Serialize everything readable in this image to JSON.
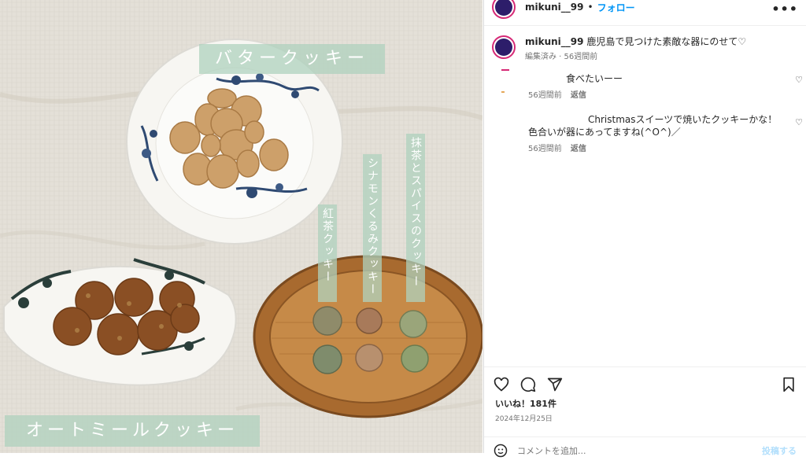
{
  "photo": {
    "label_butter": "バタークッキー",
    "label_oatmeal": "オートミールクッキー",
    "label_tea": "紅茶クッキー",
    "label_cinnamon": "シナモンくるみクッキー",
    "label_matcha": "抹茶とスパイスのクッキー"
  },
  "header": {
    "username": "mikuni__99",
    "separator": "•",
    "follow": "フォロー",
    "more": "•••"
  },
  "caption": {
    "username": "mikuni__99",
    "text": "鹿児島で見つけた素敵な器にのせて♡",
    "meta": "編集済み · 56週間前"
  },
  "comments": [
    {
      "text": "食べたいーー",
      "time": "56週間前",
      "reply": "返信"
    },
    {
      "text": "Christmasスイーツで焼いたクッキーかな！色合いが器にあってますね(^O^)／",
      "time": "56週間前",
      "reply": "返信"
    }
  ],
  "actions": {
    "likes": "いいね！181件",
    "date": "2024年12月25日"
  },
  "add_comment": {
    "placeholder": "コメントを追加...",
    "post": "投稿する"
  },
  "icons": [
    "heart-icon",
    "comment-icon",
    "share-icon",
    "bookmark-icon",
    "emoji-icon",
    "more-icon"
  ]
}
